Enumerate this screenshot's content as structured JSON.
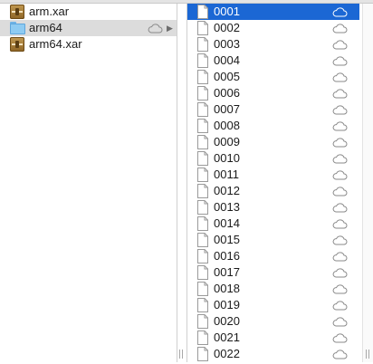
{
  "left_column": {
    "items": [
      {
        "name": "arm.xar",
        "kind": "xar-archive-icon",
        "selected": false
      },
      {
        "name": "arm64",
        "kind": "folder-icon",
        "selected": true,
        "cloud": true,
        "arrow": "▶"
      },
      {
        "name": "arm64.xar",
        "kind": "xar-archive-icon",
        "selected": false
      }
    ]
  },
  "right_column": {
    "items": [
      {
        "name": "0001",
        "selected": true
      },
      {
        "name": "0002"
      },
      {
        "name": "0003"
      },
      {
        "name": "0004"
      },
      {
        "name": "0005"
      },
      {
        "name": "0006"
      },
      {
        "name": "0007"
      },
      {
        "name": "0008"
      },
      {
        "name": "0009"
      },
      {
        "name": "0010"
      },
      {
        "name": "0011"
      },
      {
        "name": "0012"
      },
      {
        "name": "0013"
      },
      {
        "name": "0014"
      },
      {
        "name": "0015"
      },
      {
        "name": "0016"
      },
      {
        "name": "0017"
      },
      {
        "name": "0018"
      },
      {
        "name": "0019"
      },
      {
        "name": "0020"
      },
      {
        "name": "0021"
      },
      {
        "name": "0022"
      }
    ]
  },
  "colors": {
    "selection_active": "#1b67d4",
    "selection_inactive": "#dcdcdc"
  }
}
